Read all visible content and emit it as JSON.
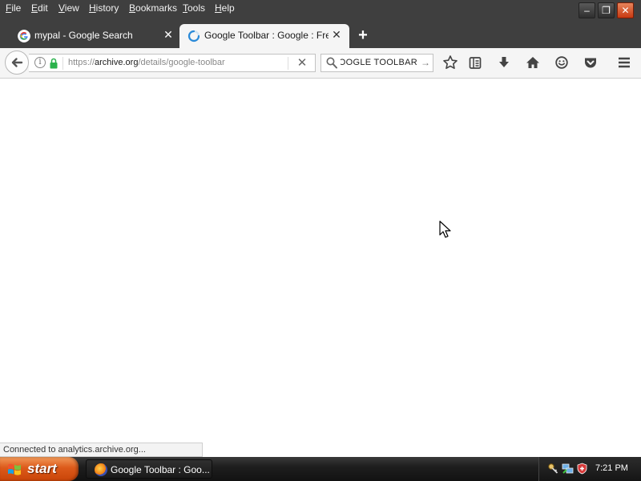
{
  "menu": [
    {
      "label": "File",
      "key": "F",
      "rest": "ile"
    },
    {
      "label": "Edit",
      "key": "E",
      "rest": "dit"
    },
    {
      "label": "View",
      "key": "V",
      "rest": "iew"
    },
    {
      "label": "History",
      "key": "H",
      "rest": "istory"
    },
    {
      "label": "Bookmarks",
      "key": "B",
      "rest": "ookmarks"
    },
    {
      "label": "Tools",
      "key": "T",
      "rest": "ools"
    },
    {
      "label": "Help",
      "key": "H",
      "rest": "elp"
    }
  ],
  "window_controls": {
    "minimize": "–",
    "restore": "❐",
    "close": "✕"
  },
  "tabs": [
    {
      "title": "mypal - Google Search",
      "icon": "google-favicon",
      "active": false
    },
    {
      "title": "Google Toolbar : Google : Free...",
      "icon": "loading-spinner",
      "active": true
    }
  ],
  "new_tab_label": "+",
  "urlbar": {
    "scheme": "https://",
    "host": "archive.org",
    "path": "/details/google-toolbar",
    "info_glyph": "i",
    "stop_glyph": "✕"
  },
  "searchbar": {
    "value": "GOOGLE TOOLBAR",
    "go_glyph": "→"
  },
  "toolbar_icons": [
    "bookmark-star-icon",
    "reading-list-icon",
    "download-icon",
    "home-icon",
    "emoji-icon",
    "pocket-icon",
    "hamburger-menu-icon"
  ],
  "status_text": "Connected to analytics.archive.org...",
  "taskbar": {
    "start_label": "start",
    "task_title": "Google Toolbar : Goo...",
    "clock": "7:21 PM"
  },
  "colors": {
    "frame": "#3f3f3f",
    "toolbar": "#f5f5f5",
    "start": "#dc5a1a",
    "close": "#c73a12"
  }
}
